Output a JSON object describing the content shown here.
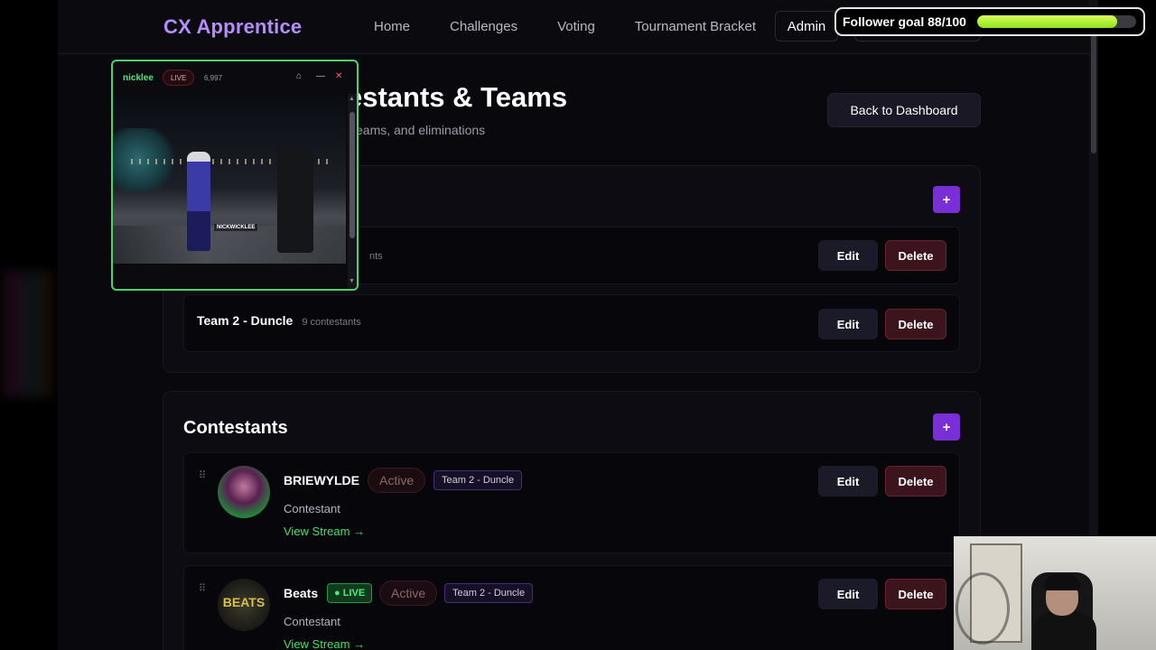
{
  "nav": {
    "brand": "CX Apprentice",
    "links": [
      "Home",
      "Challenges",
      "Voting",
      "Tournament Bracket"
    ],
    "admin": "Admin"
  },
  "header": {
    "title": "estants & Teams",
    "subtitle": "eams, and eliminations",
    "back_button": "Back to Dashboard"
  },
  "teams": {
    "add_label": "+",
    "rows": [
      {
        "name": "",
        "count": "nts",
        "edit": "Edit",
        "delete": "Delete"
      },
      {
        "name": "Team 2 - Duncle",
        "count": "9 contestants",
        "edit": "Edit",
        "delete": "Delete"
      }
    ]
  },
  "contestants": {
    "title": "Contestants",
    "add_label": "+",
    "items": [
      {
        "name": "BRIEWYLDE",
        "status": "Active",
        "live": "",
        "team": "Team 2 - Duncle",
        "role": "Contestant",
        "link": "View Stream →",
        "edit": "Edit",
        "delete": "Delete"
      },
      {
        "name": "Beats",
        "status": "Active",
        "live": "● LIVE",
        "team": "Team 2 - Duncle",
        "role": "Contestant",
        "link": "View Stream →",
        "edit": "Edit",
        "delete": "Delete",
        "avatar_text": "BEATS"
      }
    ]
  },
  "player": {
    "channel": "nicklee",
    "live": "LIVE",
    "viewers": "6,997",
    "watermark": "NICKWICKLEE"
  },
  "overlay": {
    "goal_label": "Follower goal 88/100",
    "goal_progress": 0.88,
    "accent": "#7a2fd6",
    "live_green": "#3fe06a"
  }
}
